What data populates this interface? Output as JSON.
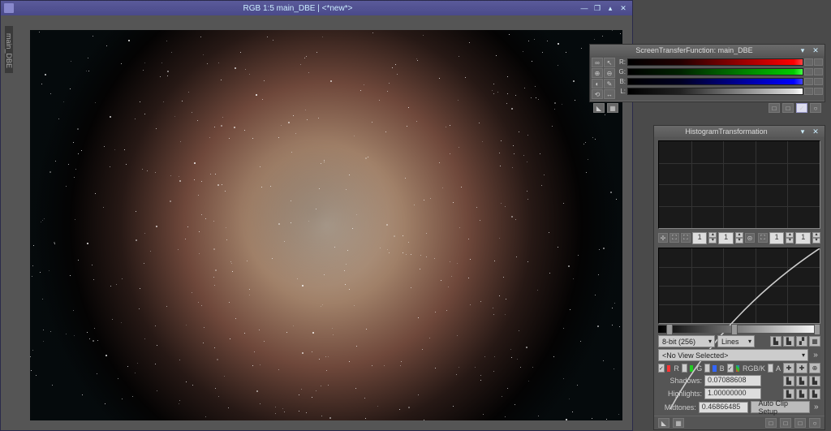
{
  "main_window": {
    "title": "RGB 1:5 main_DBE | <*new*>",
    "side_tab": "main_DBE"
  },
  "stf": {
    "title": "ScreenTransferFunction: main_DBE",
    "channels": [
      "R:",
      "G:",
      "B:",
      "L:"
    ]
  },
  "hist": {
    "title": "HistogramTransformation",
    "bit_depth": "8-bit (256)",
    "plot_mode": "Lines",
    "view": "<No View Selected>",
    "channels": {
      "r": "R",
      "g": "G",
      "b": "B",
      "rgbk": "RGB/K",
      "a": "A"
    },
    "shadows": {
      "label": "Shadows:",
      "value": "0.07088608"
    },
    "highlights": {
      "label": "Highlights:",
      "value": "1.00000000"
    },
    "midtones": {
      "label": "Midtones:",
      "value": "0.46866485"
    },
    "zoom": {
      "hx": "1",
      "hy": "1",
      "cx": "1",
      "cy": "1"
    },
    "auto_clip": "Auto Clip Setup"
  }
}
